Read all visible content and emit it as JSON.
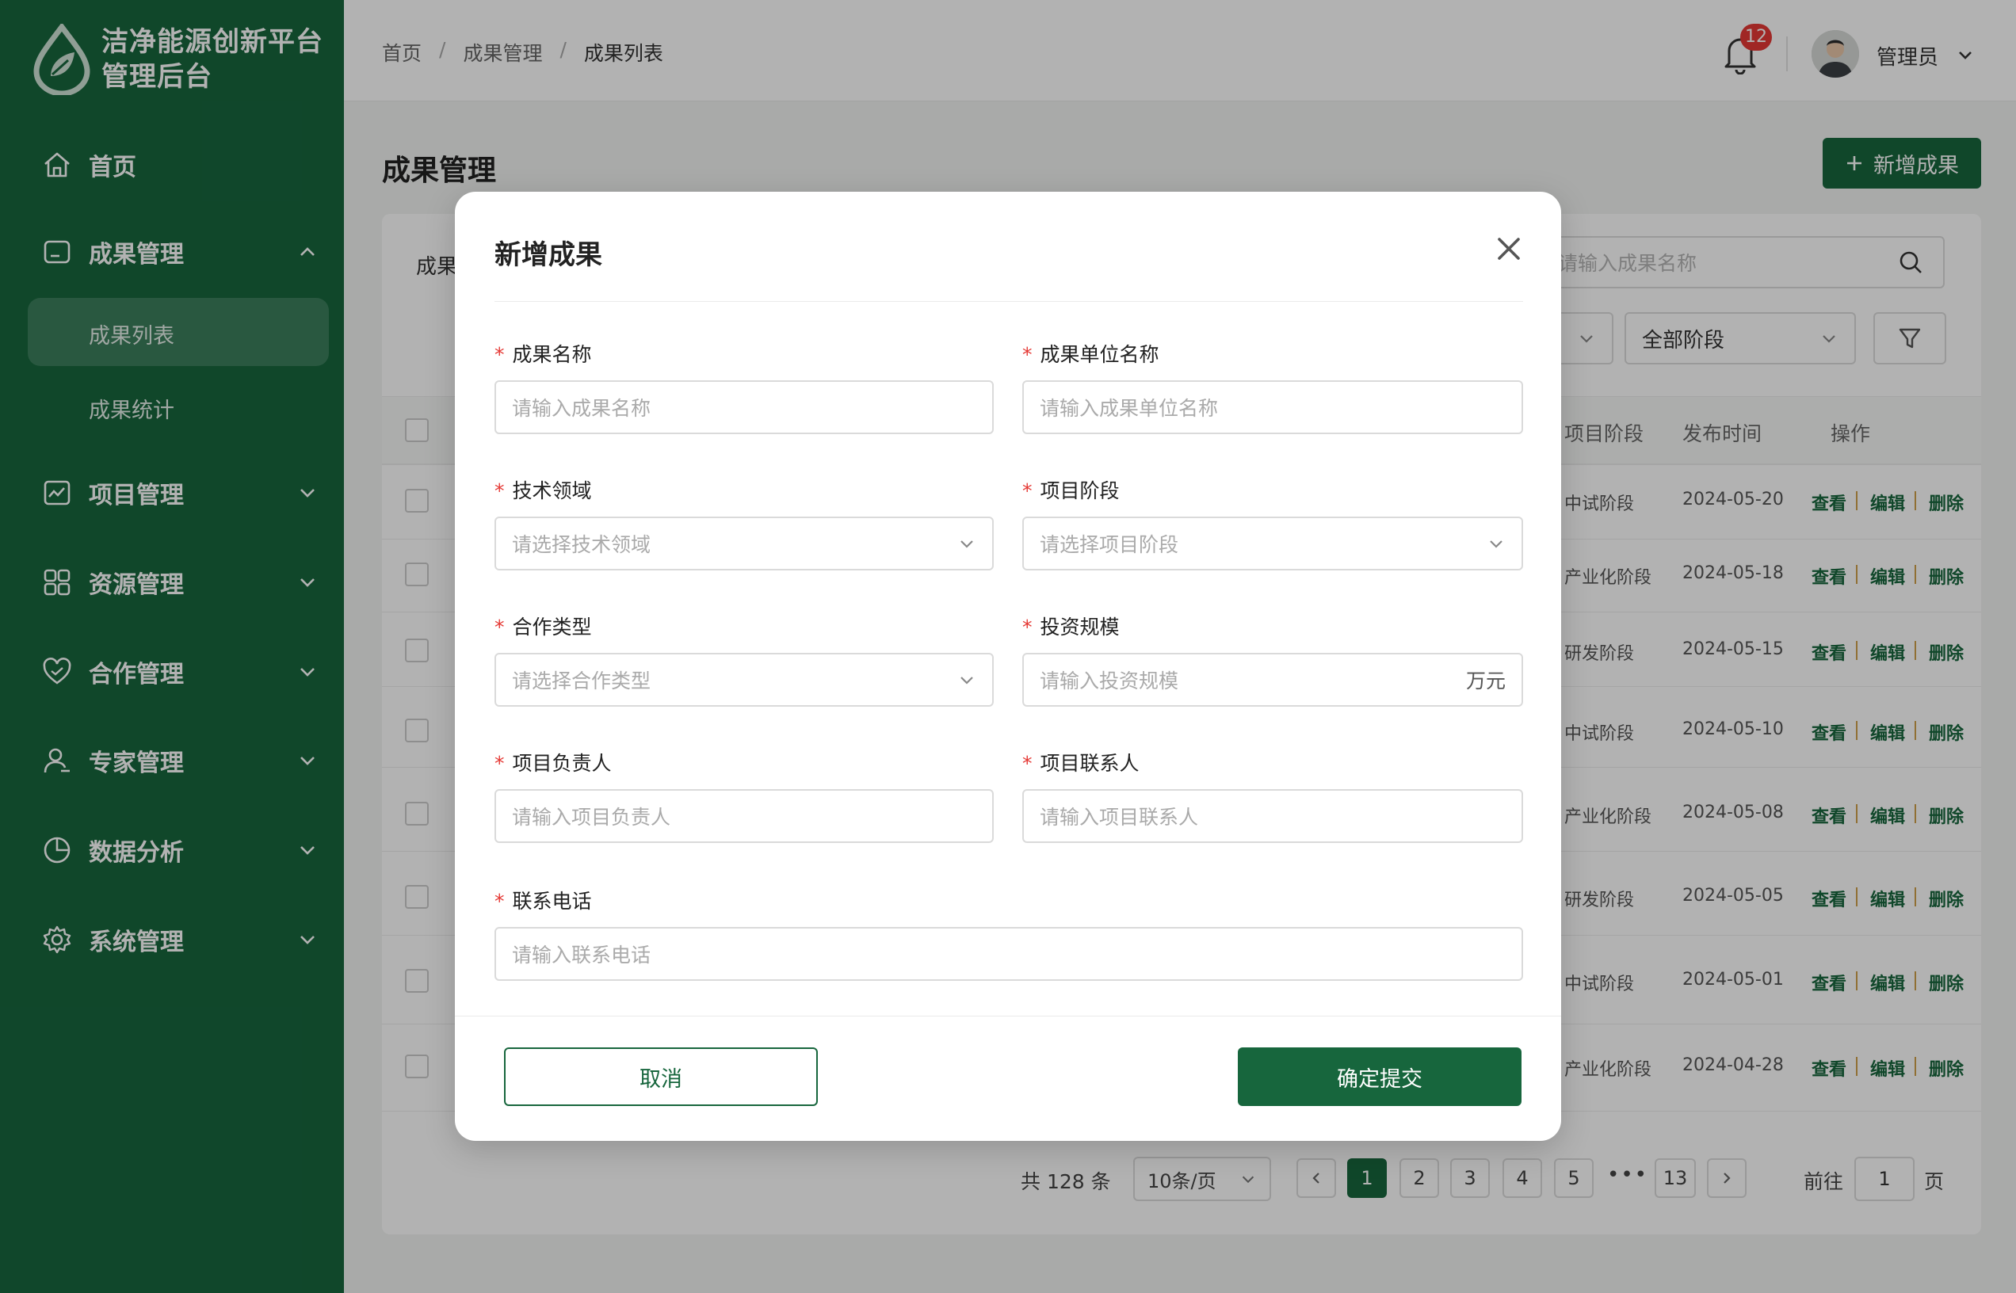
{
  "brand": {
    "line1": "洁净能源创新平台",
    "line2": "管理后台"
  },
  "sidebar": {
    "items": [
      {
        "label": "首页",
        "icon": "home-icon"
      },
      {
        "label": "成果管理",
        "icon": "achievement-icon",
        "expanded": true
      },
      {
        "label": "项目管理",
        "icon": "project-icon"
      },
      {
        "label": "资源管理",
        "icon": "resource-icon"
      },
      {
        "label": "合作管理",
        "icon": "cooperation-icon"
      },
      {
        "label": "专家管理",
        "icon": "expert-icon"
      },
      {
        "label": "数据分析",
        "icon": "chart-icon"
      },
      {
        "label": "系统管理",
        "icon": "settings-icon"
      }
    ],
    "sub_items": [
      {
        "label": "成果列表",
        "active": true
      },
      {
        "label": "成果统计"
      }
    ]
  },
  "header": {
    "breadcrumb": [
      "首页",
      "/",
      "成果管理",
      "/",
      "成果列表"
    ],
    "notification_count": "12",
    "user_name": "管理员"
  },
  "main": {
    "title": "成果管理",
    "add_button": "新增成果",
    "filter_label": "成果",
    "search_placeholder": "请输入成果名称",
    "stage_select": "全部阶段",
    "columns": {
      "stage": "项目阶段",
      "date": "发布时间",
      "ops": "操作"
    },
    "rows": [
      {
        "stage": "中试阶段",
        "date": "2024-05-20"
      },
      {
        "stage": "产业化阶段",
        "date": "2024-05-18"
      },
      {
        "stage": "研发阶段",
        "date": "2024-05-15"
      },
      {
        "stage": "中试阶段",
        "date": "2024-05-10"
      },
      {
        "stage": "产业化阶段",
        "date": "2024-05-08"
      },
      {
        "stage": "研发阶段",
        "date": "2024-05-05"
      },
      {
        "stage": "中试阶段",
        "date": "2024-05-01"
      },
      {
        "stage": "产业化阶段",
        "date": "2024-04-28"
      }
    ],
    "ops": {
      "view": "查看",
      "edit": "编辑",
      "delete": "删除"
    },
    "pagination": {
      "total": "共 128 条",
      "page_size": "10条/页",
      "pages": [
        "1",
        "2",
        "3",
        "4",
        "5"
      ],
      "ellipsis": "•••",
      "last_page": "13",
      "current": "1",
      "goto_label": "前往",
      "goto_value": "1",
      "page_suffix": "页"
    }
  },
  "modal": {
    "title": "新增成果",
    "fields": {
      "name": {
        "label": "成果名称",
        "placeholder": "请输入成果名称"
      },
      "unit": {
        "label": "成果单位名称",
        "placeholder": "请输入成果单位名称"
      },
      "domain": {
        "label": "技术领域",
        "placeholder": "请选择技术领域"
      },
      "stage": {
        "label": "项目阶段",
        "placeholder": "请选择项目阶段"
      },
      "coop": {
        "label": "合作类型",
        "placeholder": "请选择合作类型"
      },
      "invest": {
        "label": "投资规模",
        "placeholder": "请输入投资规模",
        "suffix": "万元"
      },
      "leader": {
        "label": "项目负责人",
        "placeholder": "请输入项目负责人"
      },
      "contact": {
        "label": "项目联系人",
        "placeholder": "请输入项目联系人"
      },
      "phone": {
        "label": "联系电话",
        "placeholder": "请输入联系电话"
      }
    },
    "required_mark": "*",
    "cancel": "取消",
    "submit": "确定提交"
  },
  "colors": {
    "primary": "#17663d",
    "required": "#e53935",
    "badge": "#e53935"
  }
}
